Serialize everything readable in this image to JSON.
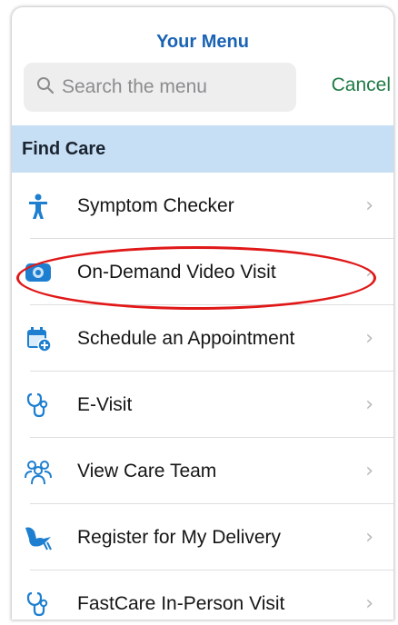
{
  "menu": {
    "title": "Your Menu",
    "search_placeholder": "Search the menu",
    "cancel_label": "Cancel",
    "section_title": "Find Care",
    "items": [
      {
        "label": "Symptom Checker",
        "icon": "person-icon"
      },
      {
        "label": "On-Demand Video Visit",
        "icon": "video-camera-icon"
      },
      {
        "label": "Schedule an Appointment",
        "icon": "calendar-add-icon"
      },
      {
        "label": "E-Visit",
        "icon": "stethoscope-icon"
      },
      {
        "label": "View Care Team",
        "icon": "care-team-icon"
      },
      {
        "label": "Register for My Delivery",
        "icon": "stork-icon"
      },
      {
        "label": "FastCare In-Person Visit",
        "icon": "stethoscope-icon"
      }
    ]
  },
  "colors": {
    "accent_blue": "#1a63b3",
    "cancel_green": "#1f7a45",
    "section_bg": "#c7dff5",
    "highlight_red": "#e01818"
  }
}
